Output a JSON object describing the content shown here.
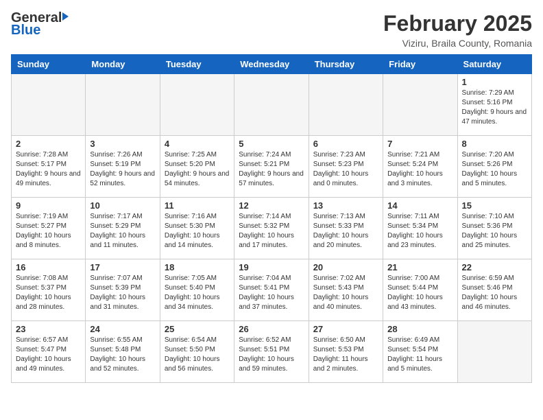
{
  "header": {
    "logo_general": "General",
    "logo_blue": "Blue",
    "month": "February 2025",
    "location": "Viziru, Braila County, Romania"
  },
  "weekdays": [
    "Sunday",
    "Monday",
    "Tuesday",
    "Wednesday",
    "Thursday",
    "Friday",
    "Saturday"
  ],
  "weeks": [
    [
      {
        "day": "",
        "info": ""
      },
      {
        "day": "",
        "info": ""
      },
      {
        "day": "",
        "info": ""
      },
      {
        "day": "",
        "info": ""
      },
      {
        "day": "",
        "info": ""
      },
      {
        "day": "",
        "info": ""
      },
      {
        "day": "1",
        "info": "Sunrise: 7:29 AM\nSunset: 5:16 PM\nDaylight: 9 hours and 47 minutes."
      }
    ],
    [
      {
        "day": "2",
        "info": "Sunrise: 7:28 AM\nSunset: 5:17 PM\nDaylight: 9 hours and 49 minutes."
      },
      {
        "day": "3",
        "info": "Sunrise: 7:26 AM\nSunset: 5:19 PM\nDaylight: 9 hours and 52 minutes."
      },
      {
        "day": "4",
        "info": "Sunrise: 7:25 AM\nSunset: 5:20 PM\nDaylight: 9 hours and 54 minutes."
      },
      {
        "day": "5",
        "info": "Sunrise: 7:24 AM\nSunset: 5:21 PM\nDaylight: 9 hours and 57 minutes."
      },
      {
        "day": "6",
        "info": "Sunrise: 7:23 AM\nSunset: 5:23 PM\nDaylight: 10 hours and 0 minutes."
      },
      {
        "day": "7",
        "info": "Sunrise: 7:21 AM\nSunset: 5:24 PM\nDaylight: 10 hours and 3 minutes."
      },
      {
        "day": "8",
        "info": "Sunrise: 7:20 AM\nSunset: 5:26 PM\nDaylight: 10 hours and 5 minutes."
      }
    ],
    [
      {
        "day": "9",
        "info": "Sunrise: 7:19 AM\nSunset: 5:27 PM\nDaylight: 10 hours and 8 minutes."
      },
      {
        "day": "10",
        "info": "Sunrise: 7:17 AM\nSunset: 5:29 PM\nDaylight: 10 hours and 11 minutes."
      },
      {
        "day": "11",
        "info": "Sunrise: 7:16 AM\nSunset: 5:30 PM\nDaylight: 10 hours and 14 minutes."
      },
      {
        "day": "12",
        "info": "Sunrise: 7:14 AM\nSunset: 5:32 PM\nDaylight: 10 hours and 17 minutes."
      },
      {
        "day": "13",
        "info": "Sunrise: 7:13 AM\nSunset: 5:33 PM\nDaylight: 10 hours and 20 minutes."
      },
      {
        "day": "14",
        "info": "Sunrise: 7:11 AM\nSunset: 5:34 PM\nDaylight: 10 hours and 23 minutes."
      },
      {
        "day": "15",
        "info": "Sunrise: 7:10 AM\nSunset: 5:36 PM\nDaylight: 10 hours and 25 minutes."
      }
    ],
    [
      {
        "day": "16",
        "info": "Sunrise: 7:08 AM\nSunset: 5:37 PM\nDaylight: 10 hours and 28 minutes."
      },
      {
        "day": "17",
        "info": "Sunrise: 7:07 AM\nSunset: 5:39 PM\nDaylight: 10 hours and 31 minutes."
      },
      {
        "day": "18",
        "info": "Sunrise: 7:05 AM\nSunset: 5:40 PM\nDaylight: 10 hours and 34 minutes."
      },
      {
        "day": "19",
        "info": "Sunrise: 7:04 AM\nSunset: 5:41 PM\nDaylight: 10 hours and 37 minutes."
      },
      {
        "day": "20",
        "info": "Sunrise: 7:02 AM\nSunset: 5:43 PM\nDaylight: 10 hours and 40 minutes."
      },
      {
        "day": "21",
        "info": "Sunrise: 7:00 AM\nSunset: 5:44 PM\nDaylight: 10 hours and 43 minutes."
      },
      {
        "day": "22",
        "info": "Sunrise: 6:59 AM\nSunset: 5:46 PM\nDaylight: 10 hours and 46 minutes."
      }
    ],
    [
      {
        "day": "23",
        "info": "Sunrise: 6:57 AM\nSunset: 5:47 PM\nDaylight: 10 hours and 49 minutes."
      },
      {
        "day": "24",
        "info": "Sunrise: 6:55 AM\nSunset: 5:48 PM\nDaylight: 10 hours and 52 minutes."
      },
      {
        "day": "25",
        "info": "Sunrise: 6:54 AM\nSunset: 5:50 PM\nDaylight: 10 hours and 56 minutes."
      },
      {
        "day": "26",
        "info": "Sunrise: 6:52 AM\nSunset: 5:51 PM\nDaylight: 10 hours and 59 minutes."
      },
      {
        "day": "27",
        "info": "Sunrise: 6:50 AM\nSunset: 5:53 PM\nDaylight: 11 hours and 2 minutes."
      },
      {
        "day": "28",
        "info": "Sunrise: 6:49 AM\nSunset: 5:54 PM\nDaylight: 11 hours and 5 minutes."
      },
      {
        "day": "",
        "info": ""
      }
    ]
  ]
}
